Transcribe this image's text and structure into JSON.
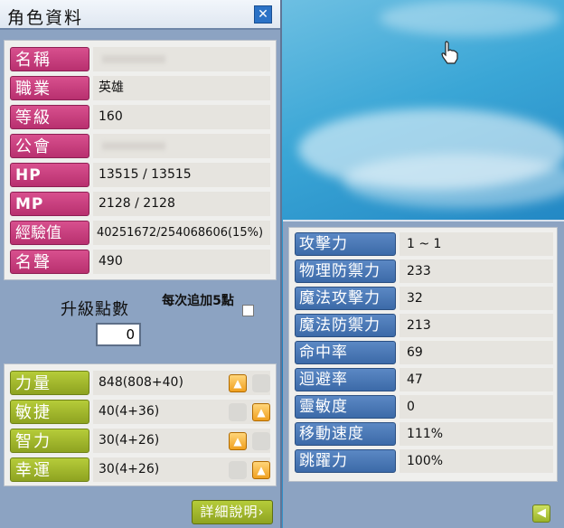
{
  "window": {
    "title": "角色資料",
    "close_icon": "close-icon"
  },
  "info": [
    {
      "label": "名稱",
      "value": ""
    },
    {
      "label": "職業",
      "value": "英雄"
    },
    {
      "label": "等級",
      "value": "160"
    },
    {
      "label": "公會",
      "value": ""
    },
    {
      "label": "HP",
      "value": "13515 / 13515"
    },
    {
      "label": "MP",
      "value": "2128 / 2128"
    },
    {
      "label": "經驗值",
      "value": "40251672/254068606(15%)"
    },
    {
      "label": "名聲",
      "value": "490"
    }
  ],
  "ability_points": {
    "label": "升級點數",
    "value": "0",
    "auto_label": "每次追加5點",
    "auto_checked": false
  },
  "stats": [
    {
      "label": "力量",
      "value": "848(808+40)"
    },
    {
      "label": "敏捷",
      "value": "40(4+36)"
    },
    {
      "label": "智力",
      "value": "30(4+26)"
    },
    {
      "label": "幸運",
      "value": "30(4+26)"
    }
  ],
  "detail_button": "詳細說明›",
  "extended": [
    {
      "label": "攻擊力",
      "value": "1 ~ 1"
    },
    {
      "label": "物理防禦力",
      "value": "233"
    },
    {
      "label": "魔法攻擊力",
      "value": "32"
    },
    {
      "label": "魔法防禦力",
      "value": "213"
    },
    {
      "label": "命中率",
      "value": "69"
    },
    {
      "label": "迴避率",
      "value": "47"
    },
    {
      "label": "靈敏度",
      "value": "0"
    },
    {
      "label": "移動速度",
      "value": "111%"
    },
    {
      "label": "跳躍力",
      "value": "100%"
    }
  ],
  "colors": {
    "label_pink": "#c83a7c",
    "label_olive": "#9fb62b",
    "label_blue": "#4a78b6",
    "window_bg": "#8ca3c2"
  }
}
